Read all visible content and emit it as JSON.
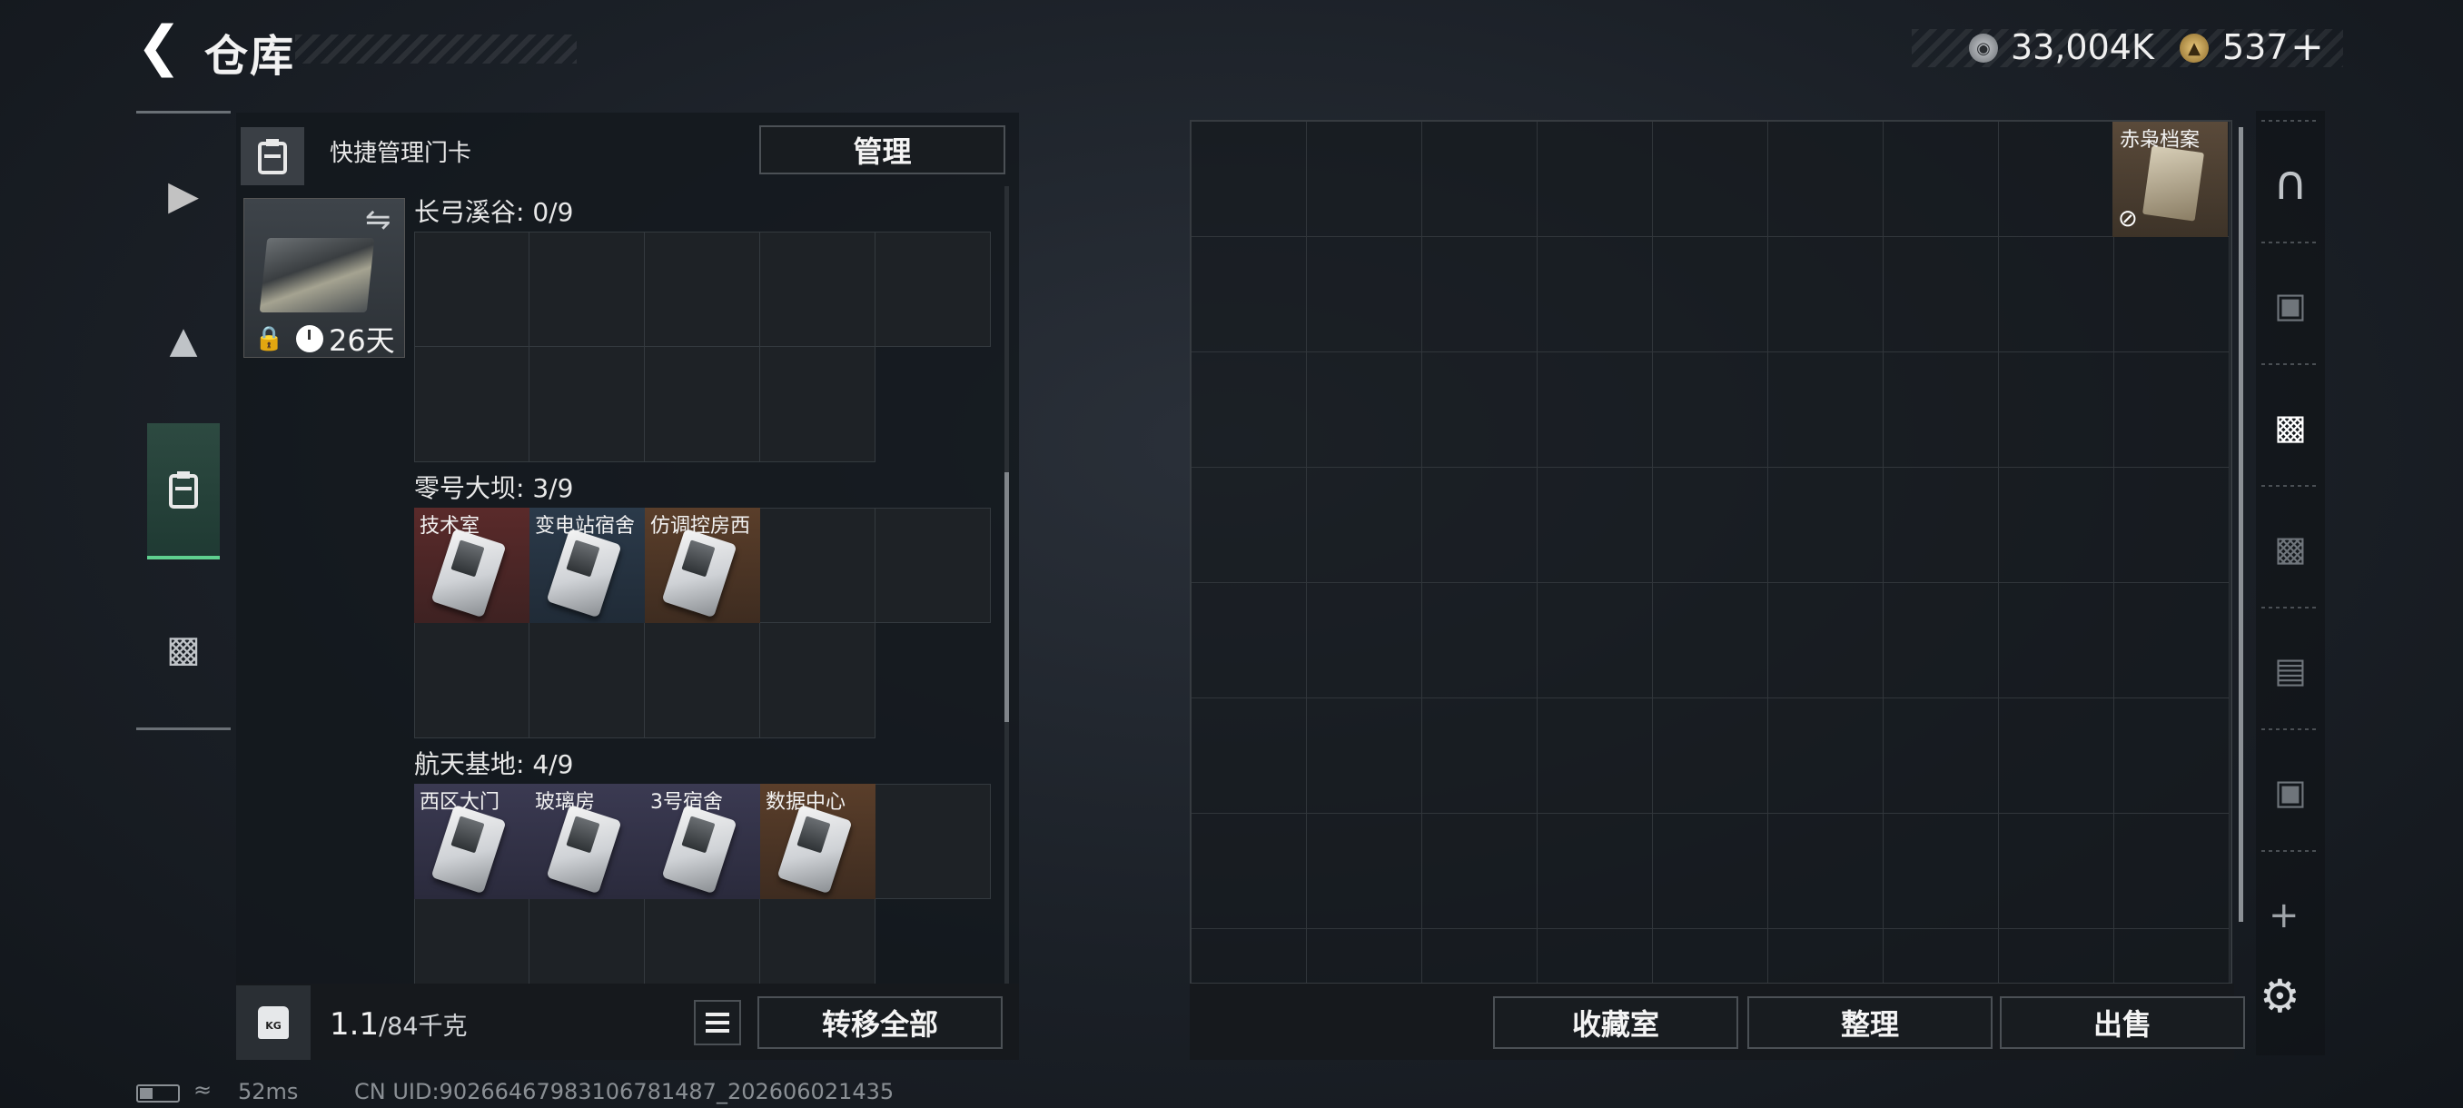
{
  "header": {
    "title": "仓库",
    "back_icon": "back-arrow-icon"
  },
  "currency": {
    "silver": "33,004K",
    "gold": "537",
    "gold_plus": "+"
  },
  "left_nav": [
    {
      "name": "weapon-icon",
      "glyph": "🔫"
    },
    {
      "name": "backpack-icon",
      "glyph": "🎒"
    },
    {
      "name": "keycard-holder-icon",
      "glyph": "▮",
      "active": true
    },
    {
      "name": "toolbox-icon",
      "glyph": "🧰"
    }
  ],
  "quick": {
    "label": "快捷管理门卡",
    "manage": "管理"
  },
  "keycard": {
    "days": "26天"
  },
  "sections": [
    {
      "title": "长弓溪谷: 0/9",
      "items": []
    },
    {
      "title": "零号大坝: 3/9",
      "items": [
        {
          "label": "技术室",
          "color": "red"
        },
        {
          "label": "变电站宿舍",
          "color": "blue"
        },
        {
          "label": "仿调控房西",
          "color": "brown"
        }
      ]
    },
    {
      "title": "航天基地: 4/9",
      "items": [
        {
          "label": "西区大门",
          "color": "purple"
        },
        {
          "label": "玻璃房",
          "color": "purple"
        },
        {
          "label": "3号宿舍",
          "color": "purple"
        },
        {
          "label": "数据中心",
          "color": "brown"
        }
      ]
    }
  ],
  "weight": {
    "value": "1.1",
    "max": "/84千克",
    "icon_text": "KG"
  },
  "buttons": {
    "transfer_all": "转移全部",
    "vault": "收藏室",
    "sort": "整理",
    "sell": "出售"
  },
  "archive": {
    "label": "赤枭档案"
  },
  "status": {
    "ping": "52ms",
    "uid": "CN UID:9026646798310678​1487_202606021435"
  }
}
